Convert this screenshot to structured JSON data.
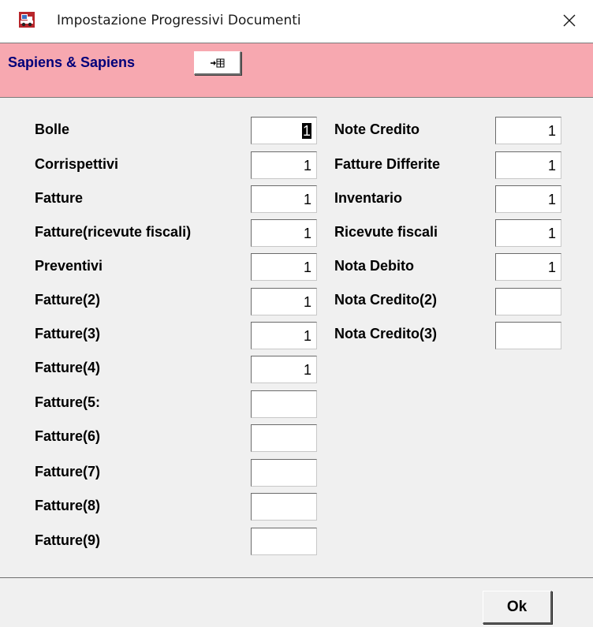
{
  "window": {
    "title": "Impostazione Progressivi Documenti",
    "close_glyph": "✕",
    "app_icon": "forklift-truck-icon",
    "close_icon": "close-icon"
  },
  "header": {
    "company": "Sapiens & Sapiens",
    "tool_button_icon": "import-to-grid-icon",
    "background_color": "#f7a8b0",
    "company_color": "#00007a"
  },
  "left_column": [
    {
      "label": "Bolle",
      "value": "1"
    },
    {
      "label": "Corrispettivi",
      "value": "1"
    },
    {
      "label": "Fatture",
      "value": "1"
    },
    {
      "label": "Fatture(ricevute fiscali)",
      "value": "1"
    },
    {
      "label": "Preventivi",
      "value": "1"
    },
    {
      "label": "Fatture(2)",
      "value": "1"
    },
    {
      "label": "Fatture(3)",
      "value": "1"
    },
    {
      "label": "Fatture(4)",
      "value": "1"
    },
    {
      "label": "Fatture(5:",
      "value": ""
    },
    {
      "label": "Fatture(6)",
      "value": ""
    },
    {
      "label": "Fatture(7)",
      "value": ""
    },
    {
      "label": "Fatture(8)",
      "value": ""
    },
    {
      "label": "Fatture(9)",
      "value": ""
    }
  ],
  "right_column": [
    {
      "label": "Note Credito",
      "value": "1"
    },
    {
      "label": "Fatture Differite",
      "value": "1"
    },
    {
      "label": "Inventario",
      "value": "1"
    },
    {
      "label": "Ricevute fiscali",
      "value": "1"
    },
    {
      "label": "Nota Debito",
      "value": "1"
    },
    {
      "label": "Nota Credito(2)",
      "value": ""
    },
    {
      "label": "Nota Credito(3)",
      "value": ""
    }
  ],
  "footer": {
    "ok_label": "Ok"
  }
}
